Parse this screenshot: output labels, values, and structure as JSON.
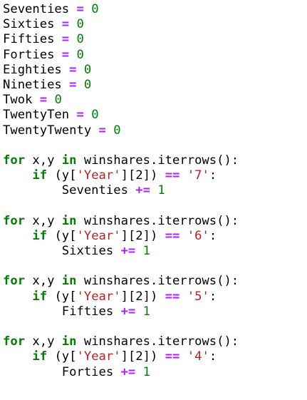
{
  "colors": {
    "keyword": "#008000",
    "operator": "#aa22ff",
    "number": "#008000",
    "string": "#ba2121",
    "text": "#000000",
    "background": "#ffffff"
  },
  "code": {
    "lines": [
      [
        {
          "t": "Seventies ",
          "c": ""
        },
        {
          "t": "=",
          "c": "op"
        },
        {
          "t": " ",
          "c": ""
        },
        {
          "t": "0",
          "c": "num"
        }
      ],
      [
        {
          "t": "Sixties ",
          "c": ""
        },
        {
          "t": "=",
          "c": "op"
        },
        {
          "t": " ",
          "c": ""
        },
        {
          "t": "0",
          "c": "num"
        }
      ],
      [
        {
          "t": "Fifties ",
          "c": ""
        },
        {
          "t": "=",
          "c": "op"
        },
        {
          "t": " ",
          "c": ""
        },
        {
          "t": "0",
          "c": "num"
        }
      ],
      [
        {
          "t": "Forties ",
          "c": ""
        },
        {
          "t": "=",
          "c": "op"
        },
        {
          "t": " ",
          "c": ""
        },
        {
          "t": "0",
          "c": "num"
        }
      ],
      [
        {
          "t": "Eighties ",
          "c": ""
        },
        {
          "t": "=",
          "c": "op"
        },
        {
          "t": " ",
          "c": ""
        },
        {
          "t": "0",
          "c": "num"
        }
      ],
      [
        {
          "t": "Nineties ",
          "c": ""
        },
        {
          "t": "=",
          "c": "op"
        },
        {
          "t": " ",
          "c": ""
        },
        {
          "t": "0",
          "c": "num"
        }
      ],
      [
        {
          "t": "Twok ",
          "c": ""
        },
        {
          "t": "=",
          "c": "op"
        },
        {
          "t": " ",
          "c": ""
        },
        {
          "t": "0",
          "c": "num"
        }
      ],
      [
        {
          "t": "TwentyTen ",
          "c": ""
        },
        {
          "t": "=",
          "c": "op"
        },
        {
          "t": " ",
          "c": ""
        },
        {
          "t": "0",
          "c": "num"
        }
      ],
      [
        {
          "t": "TwentyTwenty ",
          "c": ""
        },
        {
          "t": "=",
          "c": "op"
        },
        {
          "t": " ",
          "c": ""
        },
        {
          "t": "0",
          "c": "num"
        }
      ],
      [],
      [
        {
          "t": "for",
          "c": "kw"
        },
        {
          "t": " x,y ",
          "c": ""
        },
        {
          "t": "in",
          "c": "kw"
        },
        {
          "t": " winshares.iterrows():",
          "c": ""
        }
      ],
      [
        {
          "t": "    ",
          "c": ""
        },
        {
          "t": "if",
          "c": "kw"
        },
        {
          "t": " (y[",
          "c": ""
        },
        {
          "t": "'Year'",
          "c": "str"
        },
        {
          "t": "][2]) ",
          "c": ""
        },
        {
          "t": "==",
          "c": "op"
        },
        {
          "t": " ",
          "c": ""
        },
        {
          "t": "'7'",
          "c": "str"
        },
        {
          "t": ":",
          "c": ""
        }
      ],
      [
        {
          "t": "        Seventies ",
          "c": ""
        },
        {
          "t": "+=",
          "c": "op"
        },
        {
          "t": " ",
          "c": ""
        },
        {
          "t": "1",
          "c": "num"
        }
      ],
      [],
      [
        {
          "t": "for",
          "c": "kw"
        },
        {
          "t": " x,y ",
          "c": ""
        },
        {
          "t": "in",
          "c": "kw"
        },
        {
          "t": " winshares.iterrows():",
          "c": ""
        }
      ],
      [
        {
          "t": "    ",
          "c": ""
        },
        {
          "t": "if",
          "c": "kw"
        },
        {
          "t": " (y[",
          "c": ""
        },
        {
          "t": "'Year'",
          "c": "str"
        },
        {
          "t": "][2]) ",
          "c": ""
        },
        {
          "t": "==",
          "c": "op"
        },
        {
          "t": " ",
          "c": ""
        },
        {
          "t": "'6'",
          "c": "str"
        },
        {
          "t": ":",
          "c": ""
        }
      ],
      [
        {
          "t": "        Sixties ",
          "c": ""
        },
        {
          "t": "+=",
          "c": "op"
        },
        {
          "t": " ",
          "c": ""
        },
        {
          "t": "1",
          "c": "num"
        }
      ],
      [],
      [
        {
          "t": "for",
          "c": "kw"
        },
        {
          "t": " x,y ",
          "c": ""
        },
        {
          "t": "in",
          "c": "kw"
        },
        {
          "t": " winshares.iterrows():",
          "c": ""
        }
      ],
      [
        {
          "t": "    ",
          "c": ""
        },
        {
          "t": "if",
          "c": "kw"
        },
        {
          "t": " (y[",
          "c": ""
        },
        {
          "t": "'Year'",
          "c": "str"
        },
        {
          "t": "][2]) ",
          "c": ""
        },
        {
          "t": "==",
          "c": "op"
        },
        {
          "t": " ",
          "c": ""
        },
        {
          "t": "'5'",
          "c": "str"
        },
        {
          "t": ":",
          "c": ""
        }
      ],
      [
        {
          "t": "        Fifties ",
          "c": ""
        },
        {
          "t": "+=",
          "c": "op"
        },
        {
          "t": " ",
          "c": ""
        },
        {
          "t": "1",
          "c": "num"
        }
      ],
      [],
      [
        {
          "t": "for",
          "c": "kw"
        },
        {
          "t": " x,y ",
          "c": ""
        },
        {
          "t": "in",
          "c": "kw"
        },
        {
          "t": " winshares.iterrows():",
          "c": ""
        }
      ],
      [
        {
          "t": "    ",
          "c": ""
        },
        {
          "t": "if",
          "c": "kw"
        },
        {
          "t": " (y[",
          "c": ""
        },
        {
          "t": "'Year'",
          "c": "str"
        },
        {
          "t": "][2]) ",
          "c": ""
        },
        {
          "t": "==",
          "c": "op"
        },
        {
          "t": " ",
          "c": ""
        },
        {
          "t": "'4'",
          "c": "str"
        },
        {
          "t": ":",
          "c": ""
        }
      ],
      [
        {
          "t": "        Forties ",
          "c": ""
        },
        {
          "t": "+=",
          "c": "op"
        },
        {
          "t": " ",
          "c": ""
        },
        {
          "t": "1",
          "c": "num"
        }
      ]
    ]
  }
}
